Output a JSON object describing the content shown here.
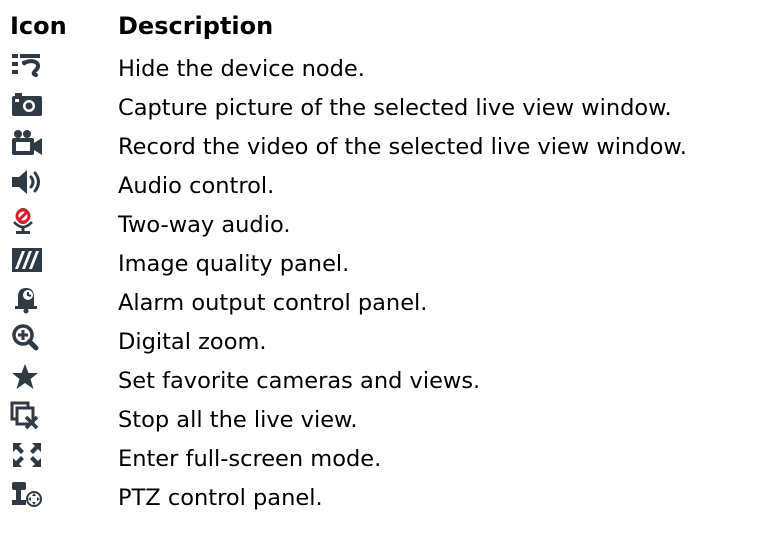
{
  "header": {
    "icon_label": "Icon",
    "description_label": "Description"
  },
  "rows": [
    {
      "icon": "hide-device-node-icon",
      "description": "Hide the device node."
    },
    {
      "icon": "camera-capture-icon",
      "description": "Capture picture of the selected live view window."
    },
    {
      "icon": "video-record-icon",
      "description": "Record the video of the selected live view window."
    },
    {
      "icon": "speaker-audio-icon",
      "description": "Audio control."
    },
    {
      "icon": "two-way-audio-mic-icon",
      "description": "Two-way audio."
    },
    {
      "icon": "image-quality-icon",
      "description": "Image quality panel."
    },
    {
      "icon": "alarm-output-bell-icon",
      "description": "Alarm output control panel."
    },
    {
      "icon": "zoom-in-magnifier-icon",
      "description": "Digital zoom."
    },
    {
      "icon": "star-favorite-icon",
      "description": "Set favorite cameras and views."
    },
    {
      "icon": "stop-all-live-view-icon",
      "description": "Stop all the live view."
    },
    {
      "icon": "full-screen-icon",
      "description": "Enter full-screen mode."
    },
    {
      "icon": "ptz-control-icon",
      "description": "PTZ control panel."
    }
  ],
  "colors": {
    "icon_dark": "#2f3a44",
    "icon_red": "#d9202a",
    "text": "#000000"
  }
}
